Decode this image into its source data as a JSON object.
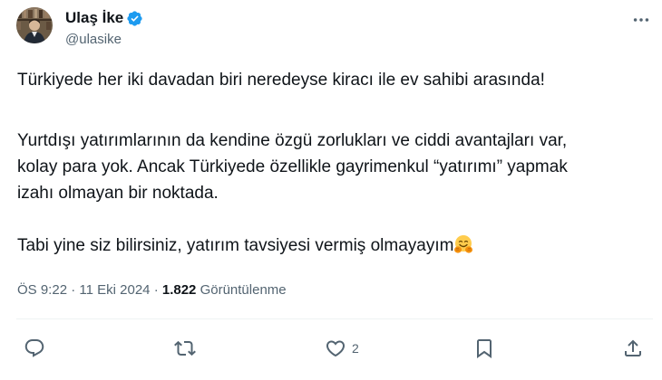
{
  "author": {
    "display_name": "Ulaş İke",
    "handle": "@ulasike",
    "verified": true
  },
  "tweet": {
    "line_1": "Türkiyede her iki davadan biri neredeyse kiracı ile ev sahibi arasında!",
    "line_2": "Yurtdışı yatırımlarının da kendine özgü zorlukları ve ciddi avantajları var,",
    "line_3": "kolay para yok. Ancak Türkiyede özellikle gayrimenkul “yatırımı” yapmak",
    "line_4": "izahı olmayan bir noktada.",
    "line_5": "Tabi yine siz bilirsiniz, yatırım tavsiyesi vermiş olmayayım",
    "emoji_name": "hugging-face-emoji"
  },
  "meta": {
    "time": "ÖS 9:22",
    "separator": "·",
    "date": "11 Eki 2024",
    "views_count": "1.822",
    "views_label": "Görüntülenme"
  },
  "actions": {
    "reply_count": "",
    "retweet_count": "",
    "like_count": "2",
    "icons": [
      "reply-icon",
      "retweet-icon",
      "like-icon",
      "bookmark-icon",
      "share-icon"
    ]
  },
  "colors": {
    "text_primary": "#0f1419",
    "text_secondary": "#536471",
    "verified_blue": "#1d9bf0",
    "divider": "#eff3f4"
  }
}
